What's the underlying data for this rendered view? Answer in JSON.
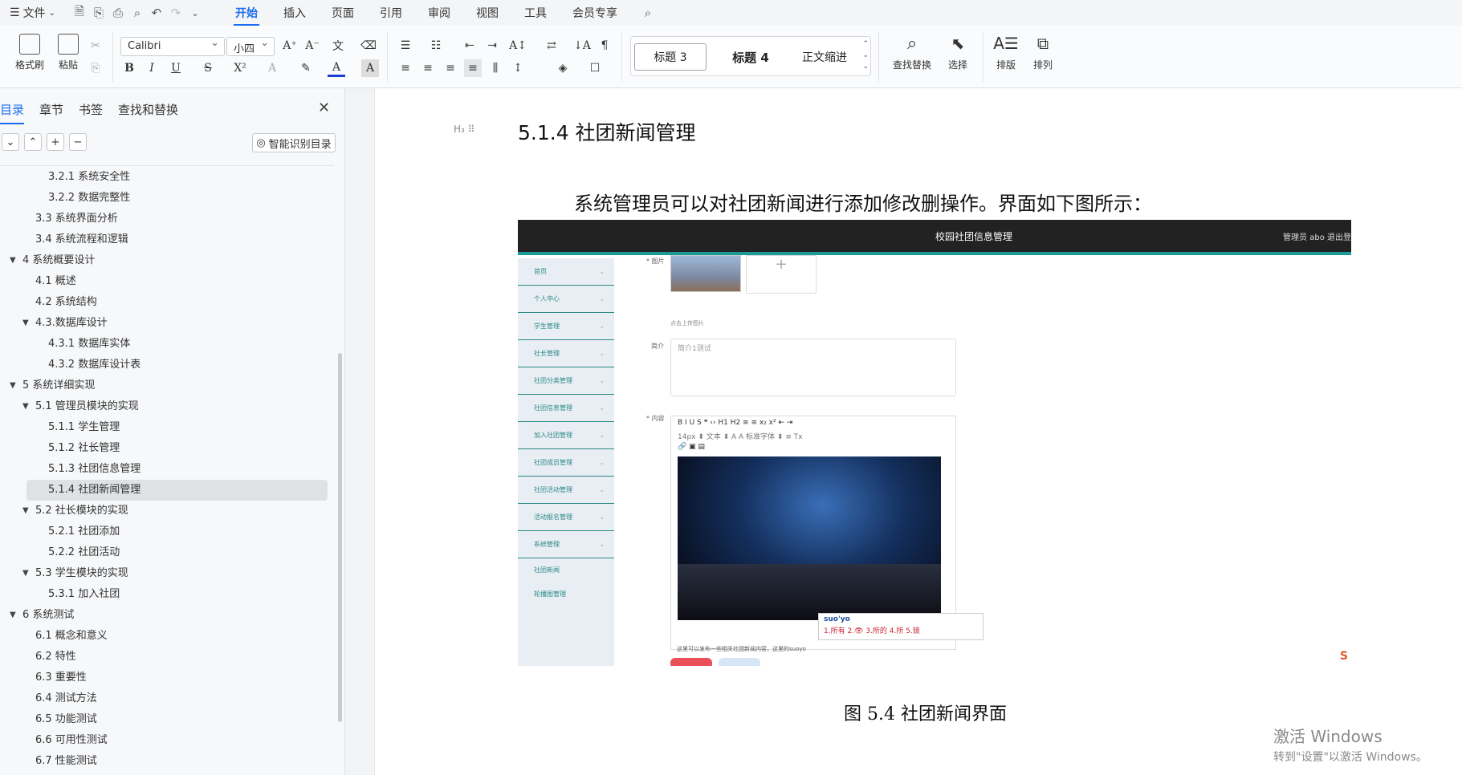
{
  "menubar": {
    "file_label": "文件",
    "tabs": [
      "开始",
      "插入",
      "页面",
      "引用",
      "审阅",
      "视图",
      "工具",
      "会员专享"
    ],
    "active_tab": "开始"
  },
  "ribbon": {
    "format_painter": "格式刷",
    "paste": "粘贴",
    "font_name": "Calibri",
    "font_size": "小四",
    "styles": [
      "标题 3",
      "标题 4",
      "正文缩进"
    ],
    "find_replace": "查找替换",
    "select": "选择",
    "layout": "排版",
    "arrange": "排列"
  },
  "sidebar": {
    "tabs": [
      "目录",
      "章节",
      "书签",
      "查找和替换"
    ],
    "active_tab": "目录",
    "ai_button": "智能识别目录",
    "toc": [
      {
        "label": "3.2.1 系统安全性",
        "level": 3,
        "arrow": ""
      },
      {
        "label": "3.2.2 数据完整性",
        "level": 3,
        "arrow": ""
      },
      {
        "label": "3.3 系统界面分析",
        "level": 2,
        "arrow": ""
      },
      {
        "label": "3.4 系统流程和逻辑",
        "level": 2,
        "arrow": ""
      },
      {
        "label": "4 系统概要设计",
        "level": 1,
        "arrow": "▼"
      },
      {
        "label": "4.1 概述",
        "level": 2,
        "arrow": ""
      },
      {
        "label": "4.2 系统结构",
        "level": 2,
        "arrow": ""
      },
      {
        "label": "4.3.数据库设计",
        "level": 2,
        "arrow": "▼"
      },
      {
        "label": "4.3.1 数据库实体",
        "level": 3,
        "arrow": ""
      },
      {
        "label": "4.3.2 数据库设计表",
        "level": 3,
        "arrow": ""
      },
      {
        "label": "5 系统详细实现",
        "level": 1,
        "arrow": "▼"
      },
      {
        "label": "5.1 管理员模块的实现",
        "level": 2,
        "arrow": "▼"
      },
      {
        "label": "5.1.1 学生管理",
        "level": 3,
        "arrow": ""
      },
      {
        "label": "5.1.2 社长管理",
        "level": 3,
        "arrow": ""
      },
      {
        "label": "5.1.3 社团信息管理",
        "level": 3,
        "arrow": ""
      },
      {
        "label": "5.1.4 社团新闻管理",
        "level": 3,
        "arrow": "",
        "selected": true
      },
      {
        "label": "5.2 社长模块的实现",
        "level": 2,
        "arrow": "▼"
      },
      {
        "label": "5.2.1 社团添加",
        "level": 3,
        "arrow": ""
      },
      {
        "label": "5.2.2 社团活动",
        "level": 3,
        "arrow": ""
      },
      {
        "label": "5.3 学生模块的实现",
        "level": 2,
        "arrow": "▼"
      },
      {
        "label": "5.3.1 加入社团",
        "level": 3,
        "arrow": ""
      },
      {
        "label": "6 系统测试",
        "level": 1,
        "arrow": "▼"
      },
      {
        "label": "6.1 概念和意义",
        "level": 2,
        "arrow": ""
      },
      {
        "label": "6.2 特性",
        "level": 2,
        "arrow": ""
      },
      {
        "label": "6.3 重要性",
        "level": 2,
        "arrow": ""
      },
      {
        "label": "6.4 测试方法",
        "level": 2,
        "arrow": ""
      },
      {
        "label": "6.5 功能测试",
        "level": 2,
        "arrow": ""
      },
      {
        "label": "6.6 可用性测试",
        "level": 2,
        "arrow": ""
      },
      {
        "label": "6.7 性能测试",
        "level": 2,
        "arrow": ""
      }
    ]
  },
  "document": {
    "heading": "5.1.4  社团新闻管理",
    "paragraph": "系统管理员可以对社团新闻进行添加修改删操作。界面如下图所示：",
    "caption": "图 5.4  社团新闻界面",
    "screenshot": {
      "title": "校园社团信息管理",
      "user": "管理员 abo   退出登",
      "menu": [
        "首页",
        "个人中心",
        "学生管理",
        "社长管理",
        "社团分类管理",
        "社团信息管理",
        "加入社团管理",
        "社团成员管理",
        "社团活动管理",
        "活动报名管理",
        "系统管理"
      ],
      "submenu": [
        "社团新闻",
        "轮播图管理"
      ],
      "label_image": "* 图片",
      "upload_hint": "点击上传图片",
      "label_intro": "简介",
      "intro_value": "简介1测试",
      "label_content": "* 内容",
      "editor_toolbar_1": "B  I  U  S   ❝  ‹›   H1 H2   ≡  ≡   x₂ x²   ⇤ ⇥",
      "editor_toolbar_2": "14px  ⬍   文本   ⬍   A  A    标准字体   ⬍   ≡   Tx",
      "content_hint": "这里可以发布一些相关社团新闻内容，这里的suoyo",
      "ime_input": "suo'yo",
      "ime_candidates": "1.所有  2.👁  3.所的  4.所  5.锁"
    }
  },
  "watermark": {
    "line1": "激活 Windows",
    "line2": "转到\"设置\"以激活 Windows。"
  }
}
